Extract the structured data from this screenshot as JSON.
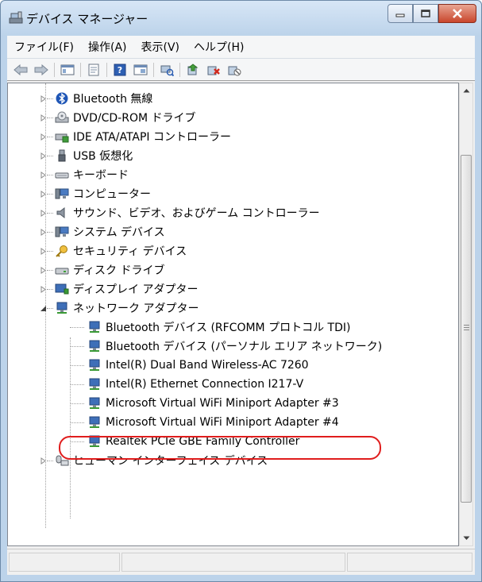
{
  "window": {
    "title": "デバイス マネージャー",
    "accent": "#bcd3ea",
    "close_color": "#c9462c"
  },
  "menu": [
    "ファイル(F)",
    "操作(A)",
    "表示(V)",
    "ヘルプ(H)"
  ],
  "toolbar_icons": [
    "back-icon",
    "forward-icon",
    "console-tree-icon",
    "properties-icon",
    "help-icon",
    "view-icon",
    "scan-hardware-icon",
    "update-driver-icon",
    "uninstall-icon",
    "disable-icon"
  ],
  "tree": [
    {
      "label": "Bluetooth 無線",
      "icon": "bluetooth-icon",
      "expanded": false,
      "level": 0
    },
    {
      "label": "DVD/CD-ROM ドライブ",
      "icon": "dvd-drive-icon",
      "expanded": false,
      "level": 0
    },
    {
      "label": "IDE ATA/ATAPI コントローラー",
      "icon": "ide-controller-icon",
      "expanded": false,
      "level": 0
    },
    {
      "label": "USB 仮想化",
      "icon": "usb-icon",
      "expanded": false,
      "level": 0
    },
    {
      "label": "キーボード",
      "icon": "keyboard-icon",
      "expanded": false,
      "level": 0
    },
    {
      "label": "コンピューター",
      "icon": "computer-icon",
      "expanded": false,
      "level": 0
    },
    {
      "label": "サウンド、ビデオ、およびゲーム コントローラー",
      "icon": "sound-icon",
      "expanded": false,
      "level": 0
    },
    {
      "label": "システム デバイス",
      "icon": "system-device-icon",
      "expanded": false,
      "level": 0
    },
    {
      "label": "セキュリティ デバイス",
      "icon": "security-device-icon",
      "expanded": false,
      "level": 0
    },
    {
      "label": "ディスク ドライブ",
      "icon": "disk-drive-icon",
      "expanded": false,
      "level": 0
    },
    {
      "label": "ディスプレイ アダプター",
      "icon": "display-adapter-icon",
      "expanded": false,
      "level": 0
    },
    {
      "label": "ネットワーク アダプター",
      "icon": "network-adapter-icon",
      "expanded": true,
      "level": 0
    },
    {
      "label": "Bluetooth デバイス (RFCOMM プロトコル TDI)",
      "icon": "network-adapter-icon",
      "level": 1
    },
    {
      "label": "Bluetooth デバイス (パーソナル エリア ネットワーク)",
      "icon": "network-adapter-icon",
      "level": 1
    },
    {
      "label": "Intel(R) Dual Band Wireless-AC 7260",
      "icon": "network-adapter-icon",
      "level": 1
    },
    {
      "label": "Intel(R) Ethernet Connection I217-V",
      "icon": "network-adapter-icon",
      "level": 1,
      "highlighted": true
    },
    {
      "label": "Microsoft Virtual WiFi Miniport Adapter #3",
      "icon": "network-adapter-icon",
      "level": 1
    },
    {
      "label": "Microsoft Virtual WiFi Miniport Adapter #4",
      "icon": "network-adapter-icon",
      "level": 1
    },
    {
      "label": "Realtek PCIe GBE Family Controller",
      "icon": "network-adapter-icon",
      "level": 1
    },
    {
      "label": "ヒューマン インターフェイス デバイス",
      "icon": "hid-icon",
      "expanded": false,
      "level": 0
    }
  ],
  "highlight_color": "#e01d1d"
}
